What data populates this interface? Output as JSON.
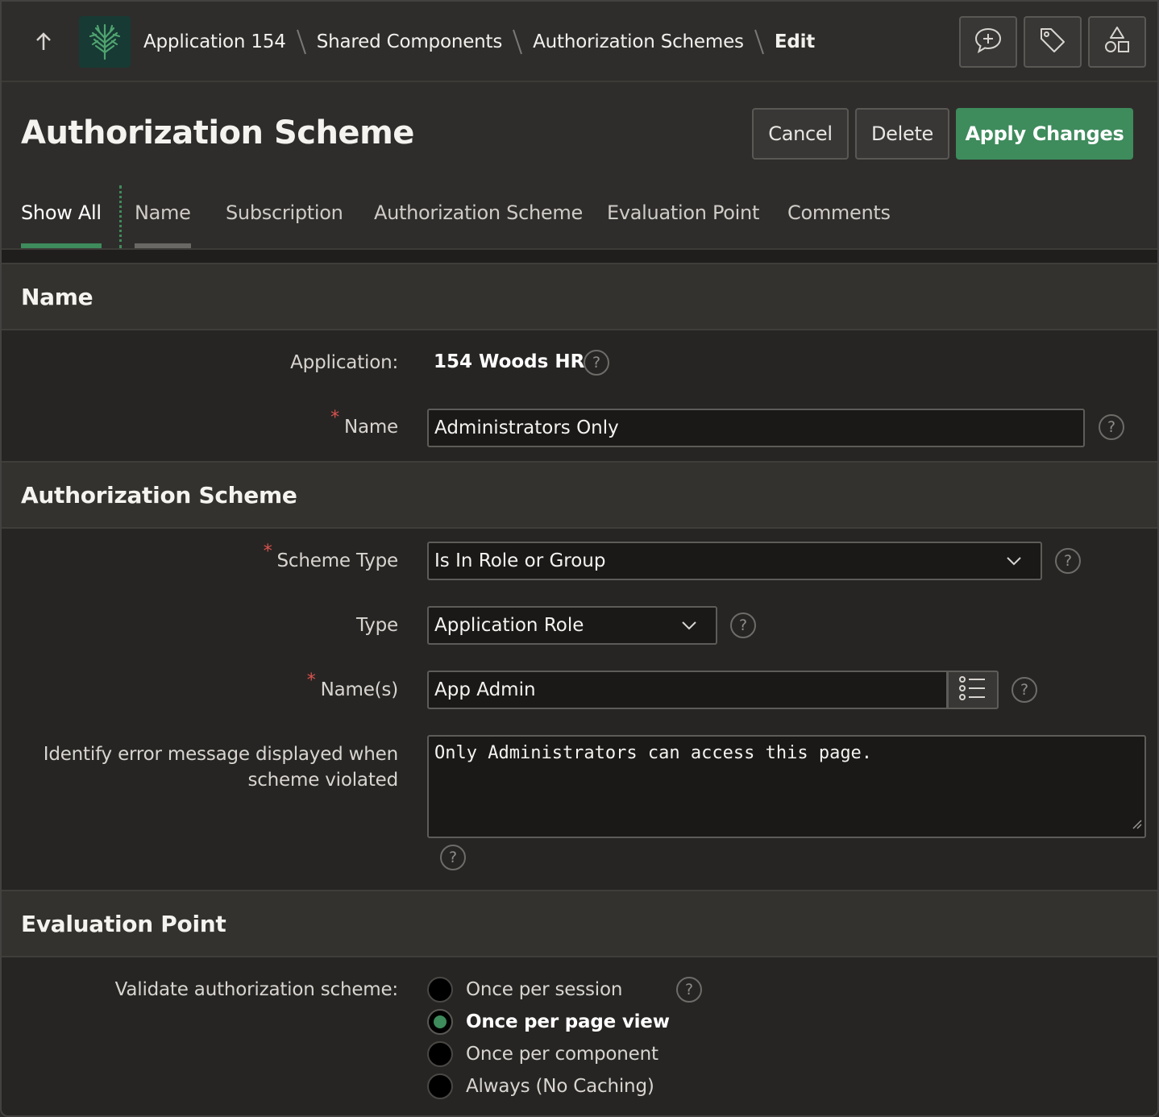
{
  "topbar": {
    "up_icon": "arrow-up-icon",
    "logo_icon": "tree-logo-icon",
    "breadcrumb": [
      "Application 154",
      "Shared Components",
      "Authorization Schemes",
      "Edit"
    ],
    "actions": [
      {
        "icon": "comment-add-icon"
      },
      {
        "icon": "tag-icon"
      },
      {
        "icon": "shapes-icon"
      }
    ]
  },
  "header": {
    "title": "Authorization Scheme",
    "cancel_label": "Cancel",
    "delete_label": "Delete",
    "apply_label": "Apply Changes"
  },
  "tabs": [
    {
      "label": "Show All",
      "active": true
    },
    {
      "label": "Name",
      "active": false
    },
    {
      "label": "Subscription",
      "active": false
    },
    {
      "label": "Authorization Scheme",
      "active": false
    },
    {
      "label": "Evaluation Point",
      "active": false
    },
    {
      "label": "Comments",
      "active": false
    }
  ],
  "sections": {
    "name": {
      "title": "Name",
      "application_label": "Application:",
      "application_value": "154 Woods HR",
      "name_label": "Name",
      "name_value": "Administrators Only"
    },
    "auth": {
      "title": "Authorization Scheme",
      "scheme_type_label": "Scheme Type",
      "scheme_type_value": "Is In Role or Group",
      "type_label": "Type",
      "type_value": "Application Role",
      "names_label": "Name(s)",
      "names_value": "App Admin",
      "error_label_1": "Identify error message displayed when",
      "error_label_2": "scheme violated",
      "error_value": "Only Administrators can access this page."
    },
    "eval": {
      "title": "Evaluation Point",
      "validate_label": "Validate authorization scheme:",
      "options": [
        {
          "label": "Once per session",
          "checked": false
        },
        {
          "label": "Once per page view",
          "checked": true
        },
        {
          "label": "Once per component",
          "checked": false
        },
        {
          "label": "Always (No Caching)",
          "checked": false
        }
      ]
    }
  },
  "help_symbol": "?",
  "required_mark": "*",
  "colors": {
    "accent": "#3e8b5c",
    "background": "#2f2d2b",
    "field_bg": "#1a1917",
    "required": "#d9534f"
  }
}
